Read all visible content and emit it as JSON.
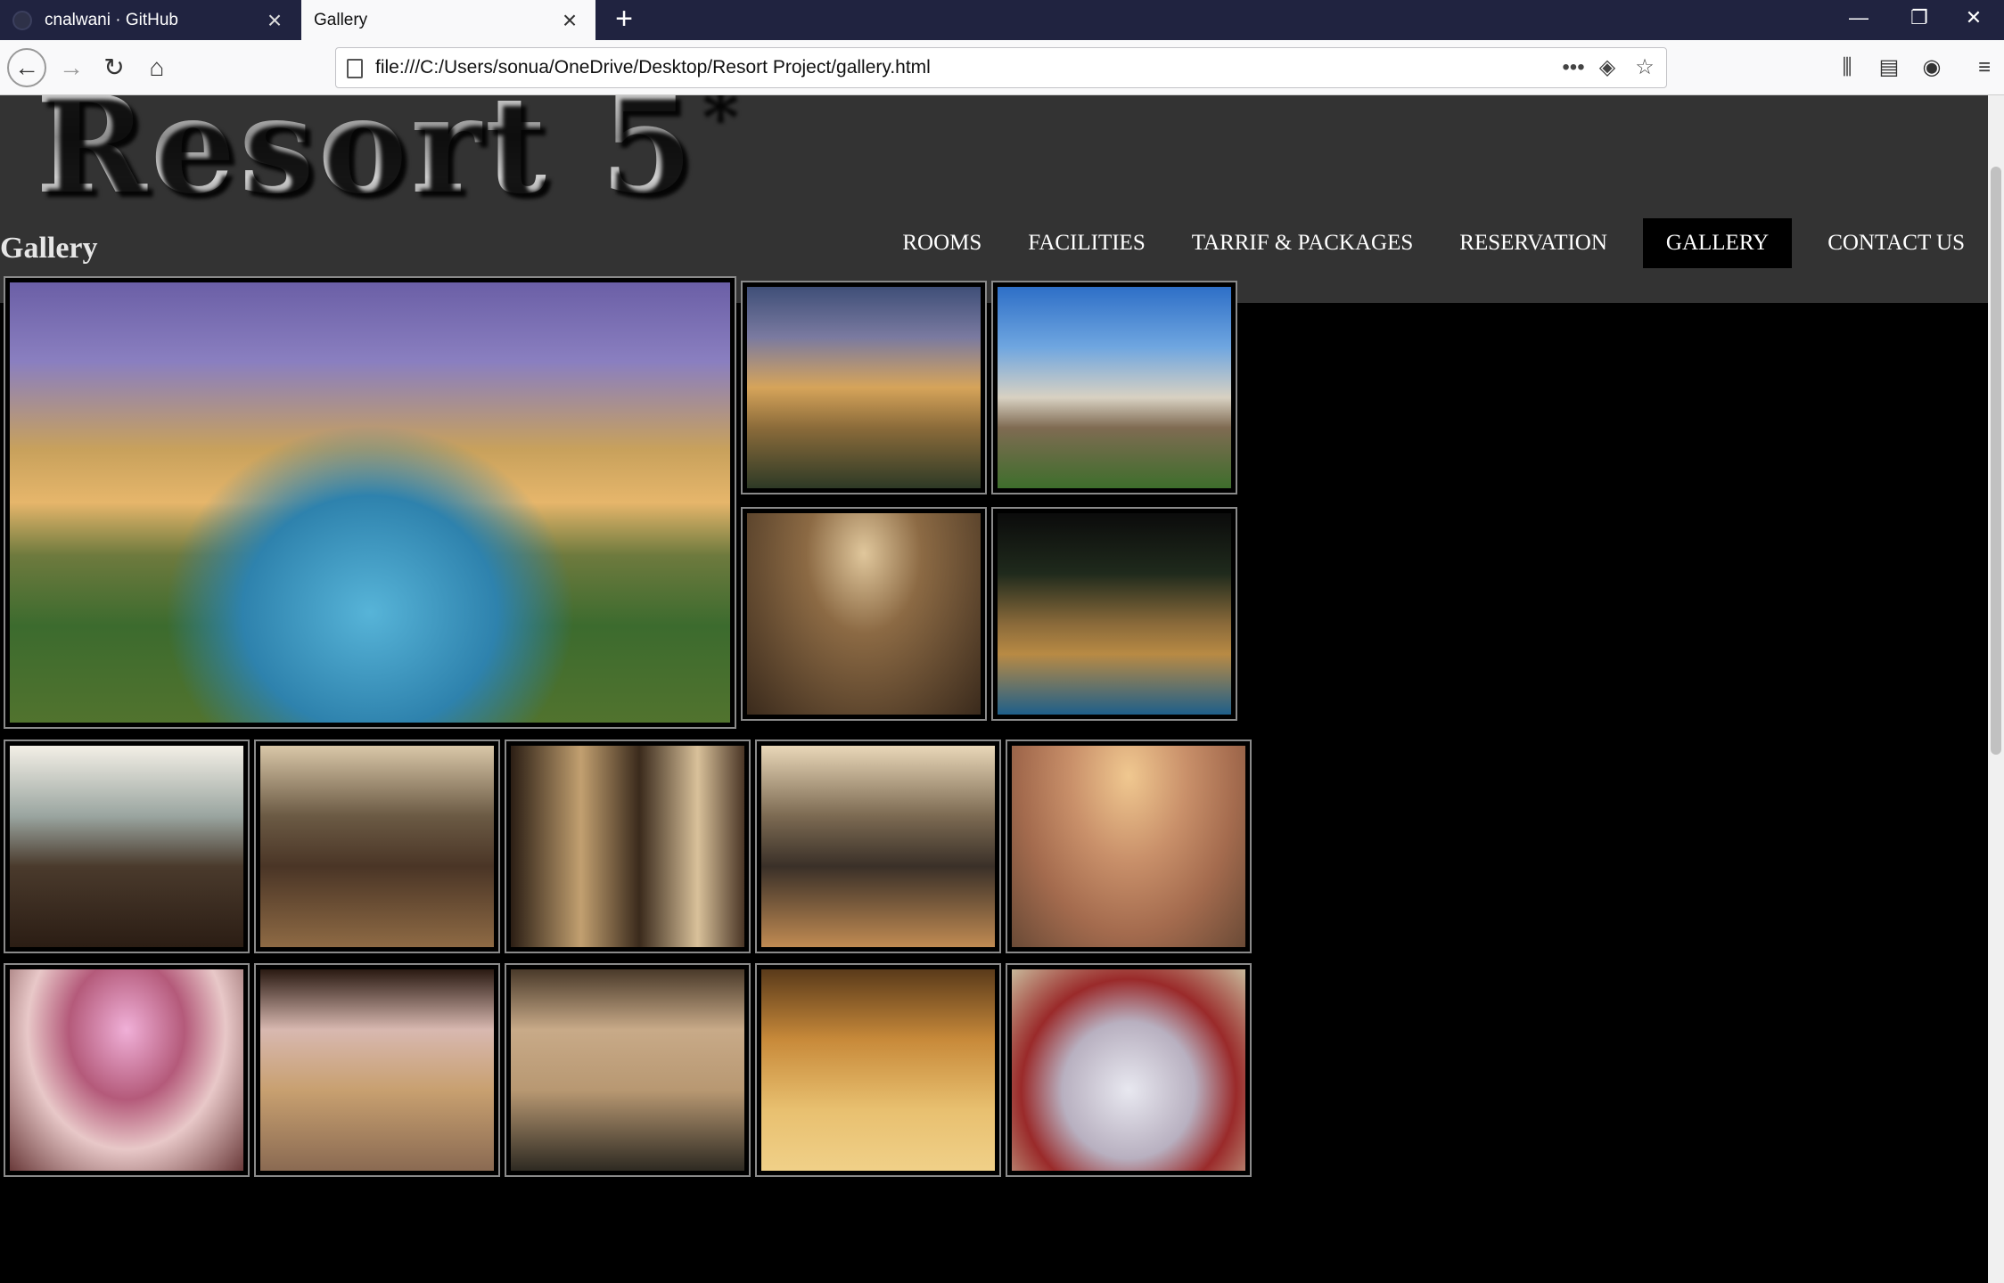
{
  "browser": {
    "tabs": [
      {
        "title": "cnalwani · GitHub",
        "active": false
      },
      {
        "title": "Gallery",
        "active": true
      }
    ],
    "new_tab_symbol": "+",
    "url": "file:///C:/Users/sonua/OneDrive/Desktop/Resort Project/gallery.html",
    "window_controls": {
      "minimize": "—",
      "restore": "❐",
      "close": "✕"
    }
  },
  "site": {
    "logo": "Resort 5",
    "logo_star": "*",
    "menu": [
      {
        "label": "ROOMS",
        "active": false
      },
      {
        "label": "FACILITIES",
        "active": false
      },
      {
        "label": "TARRIF & PACKAGES",
        "active": false
      },
      {
        "label": "RESERVATION",
        "active": false
      },
      {
        "label": "GALLERY",
        "active": true
      },
      {
        "label": "CONTACT US",
        "active": false
      }
    ],
    "heading": "Gallery"
  },
  "colors": {
    "header_bg": "#333333",
    "page_bg": "#000000",
    "tabbar_bg": "#202340",
    "active_menu_bg": "#000000"
  }
}
